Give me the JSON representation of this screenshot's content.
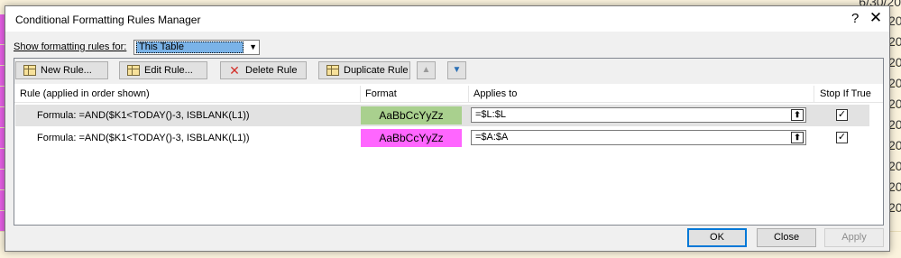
{
  "background": {
    "date_fragment": "6/30/20",
    "side_digits": [
      "20",
      "20",
      "20",
      "20",
      "20",
      "20",
      "20",
      "20",
      "20",
      "20"
    ],
    "colors": {
      "sheet": "#fbf3dd",
      "highlight": "#e760e7"
    }
  },
  "dialog": {
    "title": "Conditional Formatting Rules Manager",
    "help_glyph": "?",
    "close_glyph": "✕",
    "show_label": "Show formatting rules for:",
    "scope_value": "This Table",
    "toolbar": {
      "new_rule": "New Rule...",
      "edit_rule": "Edit Rule...",
      "delete_rule": "Delete Rule",
      "duplicate_rule": "Duplicate Rule",
      "move_up_icon": "arrow-up-icon",
      "move_down_icon": "arrow-down-icon"
    },
    "columns": {
      "rule": "Rule (applied in order shown)",
      "format": "Format",
      "applies_to": "Applies to",
      "stop_if_true": "Stop If True"
    },
    "rules": [
      {
        "rule": "Formula: =AND($K1<TODAY()-3, ISBLANK(L1))",
        "preview": "AaBbCcYyZz",
        "preview_color": "#a9d08e",
        "applies_to": "=$L:$L",
        "stop_if_true": true,
        "selected": true
      },
      {
        "rule": "Formula: =AND($K1<TODAY()-3, ISBLANK(L1))",
        "preview": "AaBbCcYyZz",
        "preview_color": "#ff66ff",
        "applies_to": "=$A:$A",
        "stop_if_true": true,
        "selected": false
      }
    ],
    "buttons": {
      "ok": "OK",
      "close": "Close",
      "apply": "Apply"
    },
    "check_glyph": "✓",
    "collapse_glyph": "⬆"
  }
}
